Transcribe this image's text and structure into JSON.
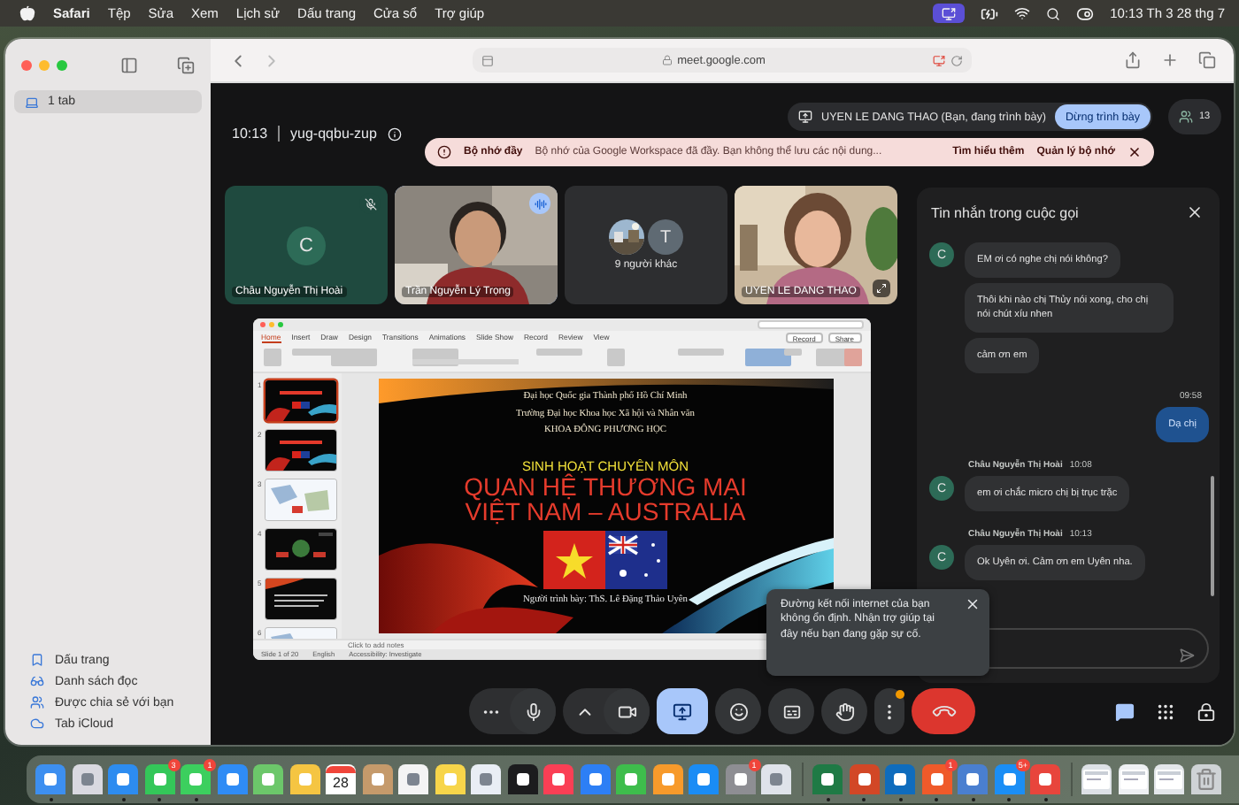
{
  "menu_bar": {
    "app_name": "Safari",
    "menus": [
      "Tệp",
      "Sửa",
      "Xem",
      "Lịch sử",
      "Dấu trang",
      "Cửa sổ",
      "Trợ giúp"
    ],
    "clock": "10:13 Th 3 28 thg 7"
  },
  "sidebar": {
    "tab_group": {
      "label": "1 tab",
      "selected": true
    },
    "items": [
      {
        "kind": "bookmarks",
        "label": "Dấu trang"
      },
      {
        "kind": "reading",
        "label": "Danh sách đọc"
      },
      {
        "kind": "shared",
        "label": "Được chia sẻ với bạn"
      },
      {
        "kind": "cloud",
        "label": "Tab iCloud"
      }
    ]
  },
  "address_bar": {
    "url": "meet.google.com"
  },
  "meeting": {
    "time": "10:13",
    "code": "yug-qqbu-zup",
    "presenter": "UYEN LE DANG THAO (Bạn, đang trình bày)",
    "stop_presenting": "Dừng trình bày",
    "participant_count": "13",
    "banner": {
      "title": "Bộ nhớ đầy",
      "message": "Bộ nhớ của Google Workspace đã đầy. Bạn không thể lưu các nội dung...",
      "link": "Tìm hiểu thêm",
      "action": "Quản lý bộ nhớ"
    },
    "tiles": [
      {
        "kind": "avatar",
        "name": "Châu Nguyễn Thị Hoài",
        "initial": "C",
        "muted": true,
        "speaking": false
      },
      {
        "kind": "video",
        "name": "Trần Nguyễn Lý Trọng",
        "muted": false,
        "speaking": true
      },
      {
        "kind": "others",
        "name": "9 người khác",
        "initial": "T",
        "muted": false,
        "speaking": false
      },
      {
        "kind": "video",
        "name": "UYEN LE DANG THAO",
        "muted": false,
        "speaking": false
      }
    ],
    "presentation": {
      "ribbon_tabs": [
        {
          "label": "Home",
          "selected": true
        },
        {
          "label": "Insert",
          "selected": false
        },
        {
          "label": "Draw",
          "selected": false
        },
        {
          "label": "Design",
          "selected": false
        },
        {
          "label": "Transitions",
          "selected": false
        },
        {
          "label": "Animations",
          "selected": false
        },
        {
          "label": "Slide Show",
          "selected": false
        },
        {
          "label": "Record",
          "selected": false
        },
        {
          "label": "Review",
          "selected": false
        },
        {
          "label": "View",
          "selected": false
        }
      ],
      "buttons": [
        "Record",
        "Share"
      ],
      "thumbnails": [
        {
          "number": "1",
          "kind": "title",
          "selected": true
        },
        {
          "number": "2",
          "kind": "title",
          "selected": false
        },
        {
          "number": "3",
          "kind": "map",
          "selected": false
        },
        {
          "number": "4",
          "kind": "diagram",
          "selected": false
        },
        {
          "number": "5",
          "kind": "text",
          "selected": false
        },
        {
          "number": "6",
          "kind": "map",
          "selected": false
        }
      ],
      "slide": {
        "institution": "Đại học Quốc gia Thành phố Hồ Chí Minh",
        "school": "Trường Đại học Khoa học Xã hội và Nhân văn",
        "faculty": "KHOA ĐÔNG PHƯƠNG HỌC",
        "subtitle": "SINH HOẠT CHUYÊN MÔN",
        "title_lines": [
          "QUAN HỆ THƯƠNG MẠI",
          "VIỆT NAM – AUSTRALIA"
        ],
        "presenter": "Người trình bày: ThS. Lê Đặng Thảo Uyên"
      },
      "notes_placeholder": "Click to add notes",
      "status": [
        "Slide 1 of 20",
        "English",
        "Accessibility: Investigate"
      ]
    },
    "chat": {
      "title": "Tin nhắn trong cuộc gọi",
      "groups": [
        {
          "kind": "received",
          "initial": "C",
          "messages": [
            "EM ơi có nghe chị nói không?",
            "Thôi khi nào chị Thủy nói xong, cho chị nói chút xíu nhen",
            "cảm ơn em"
          ]
        },
        {
          "kind": "sent",
          "time": "09:58",
          "messages": [
            "Dạ chị"
          ]
        },
        {
          "kind": "received",
          "sender": "Châu Nguyễn Thị Hoài",
          "time": "10:08",
          "initial": "C",
          "messages": [
            "em ơi chắc micro chị bị trục trặc"
          ]
        },
        {
          "kind": "received",
          "sender": "Châu Nguyễn Thị Hoài",
          "time": "10:13",
          "initial": "C",
          "messages": [
            "Ok Uyên ơi. Cảm ơn em Uyên nha."
          ]
        }
      ]
    },
    "toast": {
      "message": "Đường kết nối internet của bạn không ổn định. Nhận trợ giúp tại đây nếu bạn đang gặp sự cố."
    },
    "controls": [
      [
        {
          "kind": "options",
          "active": false,
          "alert": false
        },
        {
          "kind": "mic",
          "active": false,
          "alert": false
        }
      ],
      [
        {
          "kind": "expand",
          "active": false,
          "alert": false
        },
        {
          "kind": "camera",
          "active": false,
          "alert": false
        }
      ],
      [
        {
          "kind": "present",
          "active": true,
          "alert": false
        }
      ],
      [
        {
          "kind": "reactions",
          "active": false,
          "alert": false
        }
      ],
      [
        {
          "kind": "captions",
          "active": false,
          "alert": false
        }
      ],
      [
        {
          "kind": "hand",
          "active": false,
          "alert": false
        }
      ],
      [
        {
          "kind": "more",
          "active": false,
          "alert": true
        }
      ],
      [
        {
          "kind": "leave",
          "active": false,
          "alert": false
        }
      ]
    ],
    "side_controls": [
      {
        "kind": "chat",
        "active": true
      },
      {
        "kind": "apps",
        "active": false
      },
      {
        "kind": "host",
        "active": false
      }
    ]
  },
  "dock": [
    {
      "kind": "app",
      "color": "#3d8ff0",
      "running": true
    },
    {
      "kind": "app",
      "color": "#d9d9e0",
      "running": false
    },
    {
      "kind": "app",
      "color": "#2d8cf0",
      "running": true
    },
    {
      "kind": "app",
      "color": "#34c759",
      "badge": "3",
      "running": true
    },
    {
      "kind": "app",
      "color": "#3ccf5e",
      "badge": "1",
      "running": true
    },
    {
      "kind": "app",
      "color": "#2f8cf5",
      "running": false
    },
    {
      "kind": "app",
      "color": "#6cc76a",
      "running": false
    },
    {
      "kind": "app",
      "color": "#f5c542",
      "running": false
    },
    {
      "kind": "calendar",
      "label": "28",
      "running": false
    },
    {
      "kind": "app",
      "color": "#c59a6b",
      "running": false
    },
    {
      "kind": "app",
      "color": "#f4f4f4",
      "running": false
    },
    {
      "kind": "app",
      "color": "#f7d54a",
      "running": false
    },
    {
      "kind": "app",
      "color": "#e9eef5",
      "running": false
    },
    {
      "kind": "app",
      "color": "#1c1c1e",
      "running": false
    },
    {
      "kind": "app",
      "color": "#fa3f55",
      "running": false
    },
    {
      "kind": "app",
      "color": "#2d7ff5",
      "running": false
    },
    {
      "kind": "app",
      "color": "#3ebd4c",
      "running": false
    },
    {
      "kind": "app",
      "color": "#f79a2b",
      "running": false
    },
    {
      "kind": "app",
      "color": "#1a8cf5",
      "running": false
    },
    {
      "kind": "app",
      "color": "#8e8e93",
      "badge": "1",
      "running": false
    },
    {
      "kind": "app",
      "color": "#dfe3ea",
      "running": false
    },
    {
      "kind": "separator"
    },
    {
      "kind": "app",
      "color": "#1f7a45",
      "running": true
    },
    {
      "kind": "app",
      "color": "#d24726",
      "running": true
    },
    {
      "kind": "app",
      "color": "#0f6cbd",
      "running": true
    },
    {
      "kind": "app",
      "color": "#ef5a2a",
      "badge": "1",
      "running": true
    },
    {
      "kind": "app",
      "color": "#4a7fd0",
      "running": true
    },
    {
      "kind": "app",
      "color": "#1b8ef5",
      "badge": "5+",
      "running": true
    },
    {
      "kind": "app",
      "color": "#e8453c",
      "running": true
    },
    {
      "kind": "separator"
    },
    {
      "kind": "window",
      "color": "#dde1e6",
      "running": false
    },
    {
      "kind": "window",
      "color": "#eef0f3",
      "running": false
    },
    {
      "kind": "window",
      "color": "#e3e6ea",
      "running": false
    },
    {
      "kind": "trash",
      "color": "#cfd3d6",
      "running": false
    }
  ]
}
